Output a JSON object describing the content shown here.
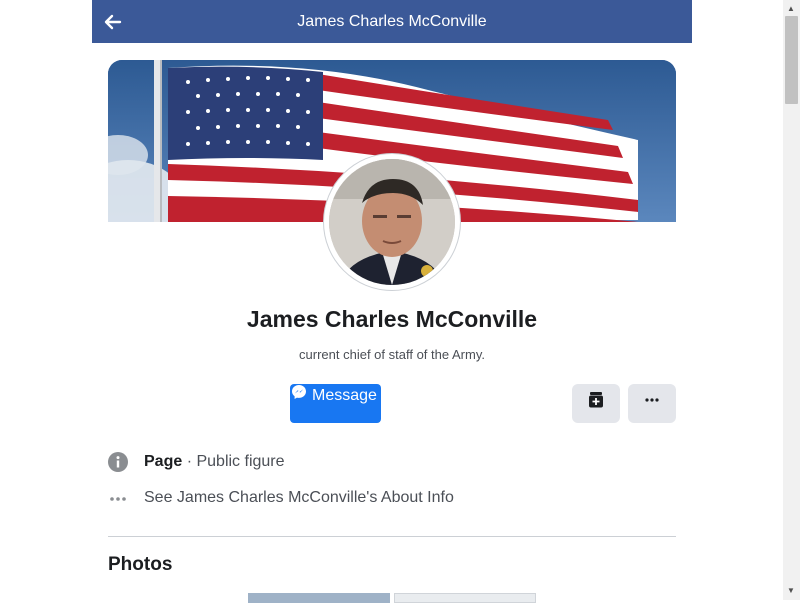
{
  "header": {
    "title": "James Charles McConville",
    "back_icon": "arrow-left-icon"
  },
  "profile": {
    "name": "James Charles McConville",
    "bio": "current chief of staff of the Army."
  },
  "actions": {
    "message_label": "Message",
    "message_icon": "messenger-icon",
    "save_icon": "save-icon",
    "more_icon": "more-dots-icon"
  },
  "info": {
    "page_label": "Page",
    "page_separator": " · ",
    "page_category": "Public figure",
    "about_link": "See James Charles McConville's About Info"
  },
  "sections": {
    "photos_title": "Photos"
  },
  "colors": {
    "header_bg": "#3b5998",
    "primary_button": "#1877f2",
    "secondary_button": "#e4e6eb"
  }
}
